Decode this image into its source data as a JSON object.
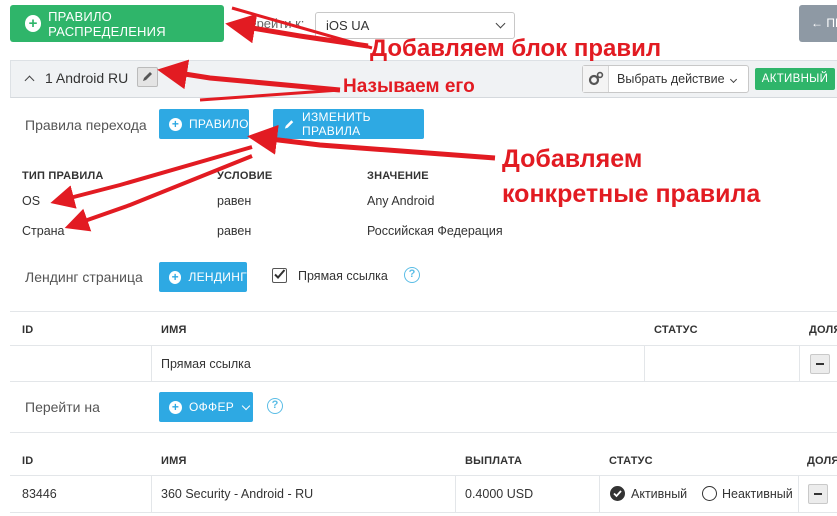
{
  "topbar": {
    "add_rule_label": "ПРАВИЛО РАСПРЕДЕЛЕНИЯ",
    "goto_label": "Перейти к:",
    "goto_value": "iOS UA",
    "back_label": "← ПЕ"
  },
  "rule_block": {
    "title": "1 Android RU",
    "action_select": "Выбрать действие",
    "status_badge": "АКТИВНЫЙ"
  },
  "transition": {
    "label": "Правила перехода",
    "add_rule": "ПРАВИЛО",
    "edit_rules": "ИЗМЕНИТЬ ПРАВИЛА"
  },
  "rules_table": {
    "headers": [
      "ТИП ПРАВИЛА",
      "УСЛОВИЕ",
      "ЗНАЧЕНИЕ"
    ],
    "rows": [
      {
        "type": "OS",
        "condition": "равен",
        "value": "Any Android"
      },
      {
        "type": "Страна",
        "condition": "равен",
        "value": "Российская Федерация"
      }
    ]
  },
  "landing": {
    "label": "Лендинг страница",
    "button": "ЛЕНДИНГ",
    "direct_link_label": "Прямая ссылка",
    "direct_link_checked": true
  },
  "landing_table": {
    "headers": [
      "ID",
      "ИМЯ",
      "СТАТУС",
      "ДОЛЯ"
    ],
    "rows": [
      {
        "id": "",
        "name": "Прямая ссылка",
        "status": ""
      }
    ]
  },
  "offer": {
    "label": "Перейти на",
    "button": "ОФФЕР"
  },
  "offer_table": {
    "headers": [
      "ID",
      "ИМЯ",
      "ВЫПЛАТА",
      "СТАТУС",
      "ДОЛЯ"
    ],
    "rows": [
      {
        "id": "83446",
        "name": "360 Security - Android - RU",
        "payout": "0.4000 USD",
        "status_active": "Активный",
        "status_inactive": "Неактивный",
        "selected": "active"
      }
    ]
  },
  "annotations": {
    "a1": "Добавляем блок правил",
    "a2": "Называем его",
    "a3_line1": "Добавляем",
    "a3_line2": "конкретные правила"
  },
  "colors": {
    "green": "#2fb56a",
    "blue": "#2ea9e3",
    "annotation_red": "#e21b22"
  }
}
